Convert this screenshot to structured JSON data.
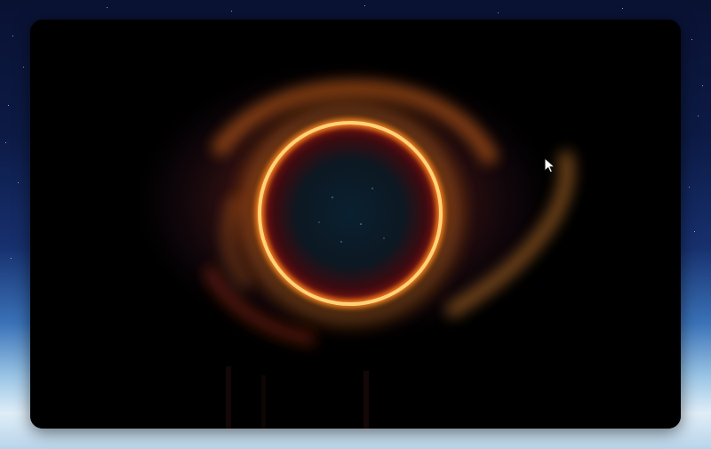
{
  "desktop": {
    "background": "space-earth-horizon",
    "accent_colors": {
      "space": "#0a1233",
      "horizon": "#9cc6e6"
    }
  },
  "window": {
    "content": "eclipse-ring-artwork",
    "background_color": "#000000",
    "ring_color": "#ffb347"
  },
  "cursor": {
    "icon": "arrow-cursor-icon"
  }
}
